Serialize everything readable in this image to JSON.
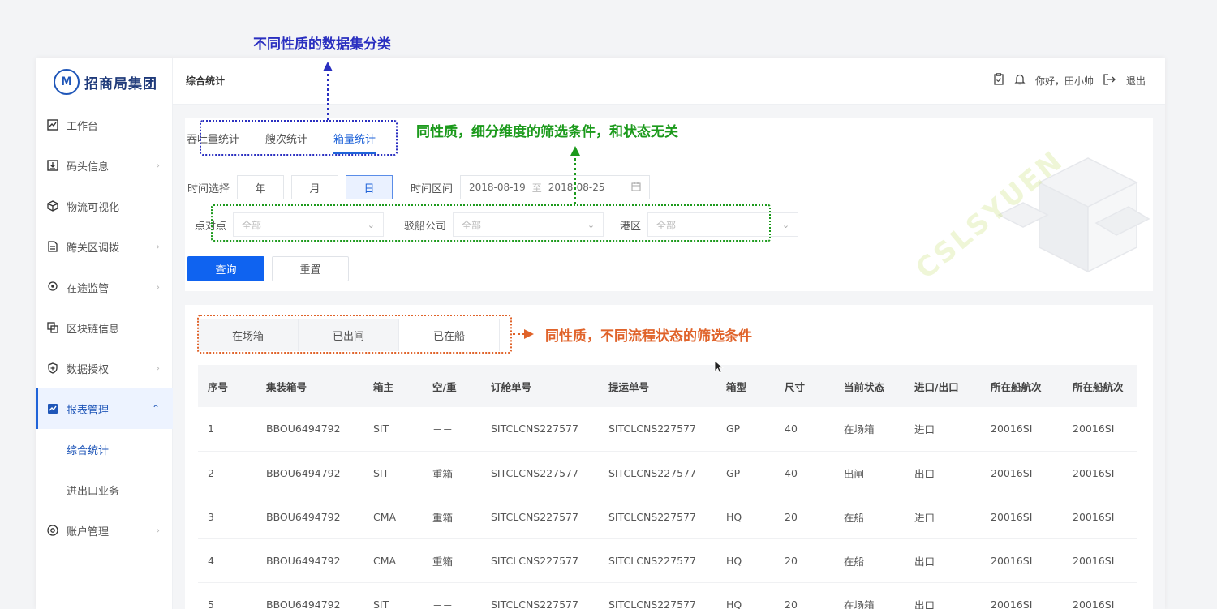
{
  "brand": {
    "name": "招商局集团",
    "mark": "M"
  },
  "header": {
    "title": "综合统计",
    "greeting": "你好，田小帅",
    "logout": "退出"
  },
  "sidebar": {
    "items": [
      {
        "label": "工作台"
      },
      {
        "label": "码头信息"
      },
      {
        "label": "物流可视化"
      },
      {
        "label": "跨关区调拨"
      },
      {
        "label": "在途监管"
      },
      {
        "label": "区块链信息"
      },
      {
        "label": "数据授权"
      },
      {
        "label": "报表管理"
      }
    ],
    "sub_items": [
      {
        "label": "综合统计"
      },
      {
        "label": "进出口业务"
      }
    ],
    "account": {
      "label": "账户管理"
    }
  },
  "filter": {
    "tabs": [
      "吞吐量统计",
      "艘次统计",
      "箱量统计"
    ],
    "time_label": "时间选择",
    "time_options": [
      "年",
      "月",
      "日"
    ],
    "range_label": "时间区间",
    "date_start": "2018-08-19",
    "date_sep": "至",
    "date_end": "2018-08-25",
    "point_label": "点对点",
    "point_value": "全部",
    "company_label": "驳船公司",
    "company_value": "全部",
    "port_label": "港区",
    "port_value": "全部",
    "query_button": "查询",
    "reset_button": "重置"
  },
  "watermark": "CSLSYUEN",
  "status_tabs": [
    "在场箱",
    "已出闸",
    "已在船"
  ],
  "table": {
    "headers": [
      "序号",
      "集装箱号",
      "箱主",
      "空/重",
      "订舱单号",
      "提运单号",
      "箱型",
      "尺寸",
      "当前状态",
      "进口/出口",
      "所在船航次",
      "所在船航次"
    ],
    "rows": [
      [
        "1",
        "BBOU6494792",
        "SIT",
        "－－",
        "SITCLCNS227577",
        "SITCLCNS227577",
        "GP",
        "40",
        "在场箱",
        "进口",
        "20016SI",
        "20016SI"
      ],
      [
        "2",
        "BBOU6494792",
        "SIT",
        "重箱",
        "SITCLCNS227577",
        "SITCLCNS227577",
        "GP",
        "40",
        "出闸",
        "出口",
        "20016SI",
        "20016SI"
      ],
      [
        "3",
        "BBOU6494792",
        "CMA",
        "重箱",
        "SITCLCNS227577",
        "SITCLCNS227577",
        "HQ",
        "20",
        "在船",
        "进口",
        "20016SI",
        "20016SI"
      ],
      [
        "4",
        "BBOU6494792",
        "CMA",
        "重箱",
        "SITCLCNS227577",
        "SITCLCNS227577",
        "HQ",
        "20",
        "在船",
        "出口",
        "20016SI",
        "20016SI"
      ],
      [
        "5",
        "BBOU6494792",
        "SIT",
        "－－",
        "SITCLCNS227577",
        "SITCLCNS227577",
        "HQ",
        "20",
        "在场箱",
        "出口",
        "20016SI",
        "20016SI"
      ]
    ]
  },
  "annotations": {
    "blue": "不同性质的数据集分类",
    "green": "同性质，细分维度的筛选条件，和状态无关",
    "orange": "同性质，不同流程状态的筛选条件"
  },
  "colors": {
    "primary": "#0f63f0",
    "blue_note": "#2a2fc0",
    "green_note": "#1c9a1c",
    "orange_note": "#e0632a"
  }
}
